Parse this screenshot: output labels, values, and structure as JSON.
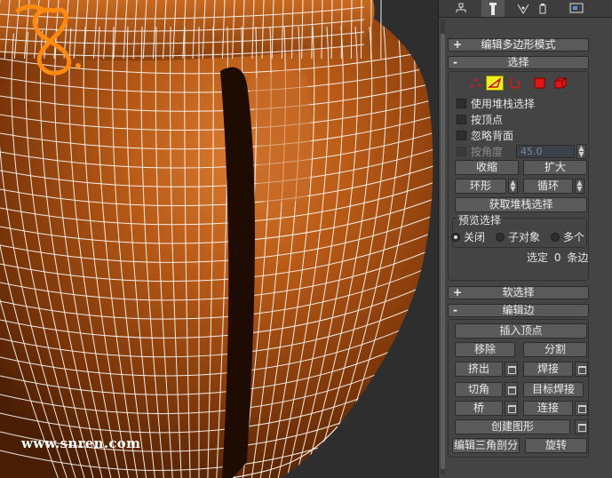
{
  "watermark": "www.snren.com",
  "colors": {
    "accent_yellow": "#f2ee1e",
    "selection_red": "#e11515",
    "vase": "#b85a16",
    "wire": "#ffffff"
  },
  "toolbar": {
    "tabs": [
      {
        "icon": "hierarchy-icon"
      },
      {
        "icon": "create-icon"
      },
      {
        "icon": "modify-icon"
      },
      {
        "icon": "utilities-icon"
      }
    ]
  },
  "edit_poly_rollout": {
    "sign": "+",
    "title": "编辑多边形模式"
  },
  "selection_rollout": {
    "sign": "-",
    "title": "选择",
    "subobject_icons": [
      "vertex-icon",
      "edge-icon",
      "border-icon",
      "polygon-icon",
      "element-icon"
    ],
    "use_stack_selection": "使用堆栈选择",
    "by_vertex": "按顶点",
    "ignore_backfacing": "忽略背面",
    "by_angle": "按角度",
    "angle_value": "45.0",
    "shrink": "收缩",
    "grow": "扩大",
    "ring": "环形",
    "loop": "循环",
    "get_stack_selection": "获取堆栈选择",
    "preview_group": "预览选择",
    "preview_off": "关闭",
    "preview_subobject": "子对象",
    "preview_multi": "多个",
    "selected_label": "选定",
    "selected_count": "0",
    "selected_unit": "条边"
  },
  "soft_selection_rollout": {
    "sign": "+",
    "title": "软选择"
  },
  "edit_edges_rollout": {
    "sign": "-",
    "title": "编辑边",
    "insert_vertex": "插入顶点",
    "remove": "移除",
    "split": "分割",
    "extrude": "挤出",
    "weld": "焊接",
    "chamfer": "切角",
    "target_weld": "目标焊接",
    "bridge": "桥",
    "connect": "连接",
    "create_shape": "创建图形",
    "edit_tri": "编辑三角剖分",
    "turn": "旋转"
  }
}
